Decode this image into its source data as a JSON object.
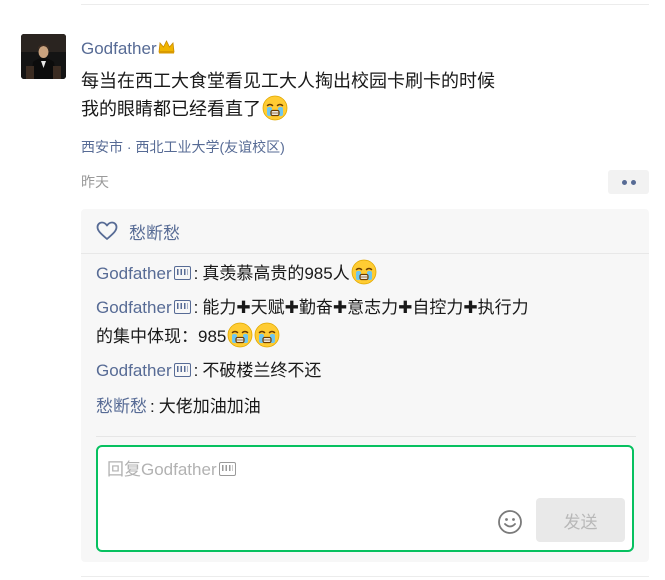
{
  "post": {
    "author": "Godfather",
    "author_badge": "crown",
    "text_line1": "每当在西工大食堂看见工大人掏出校园卡刷卡的时候",
    "text_line2": "我的眼睛都已经看直了",
    "location": "西安市 · 西北工业大学(友谊校区)",
    "time": "昨天"
  },
  "likes": {
    "names": "愁断愁"
  },
  "comments": [
    {
      "name": "Godfather",
      "sep": ":",
      "text": "真羡慕高贵的985人"
    },
    {
      "name": "Godfather",
      "sep": ":",
      "text_part1": "能力",
      "plus": "✚",
      "text_part2": "天赋",
      "text_part3": "勤奋",
      "text_part4": "意志力",
      "text_part5": "自控力",
      "text_part6": "执行力",
      "text_part7": "的集中体现：985"
    },
    {
      "name": "Godfather",
      "sep": ":",
      "text": "不破楼兰终不还"
    },
    {
      "name": "愁断愁",
      "sep": ":",
      "text": "大佬加油加油"
    }
  ],
  "reply": {
    "placeholder": "回复Godfather",
    "send_label": "发送"
  },
  "colors": {
    "link": "#576b95",
    "accent_green": "#07c160",
    "panel_bg": "#f7f7f7"
  },
  "icons": [
    "heart-icon",
    "more-icon",
    "emoji-icon",
    "crying-face-emoji",
    "crown-icon"
  ]
}
